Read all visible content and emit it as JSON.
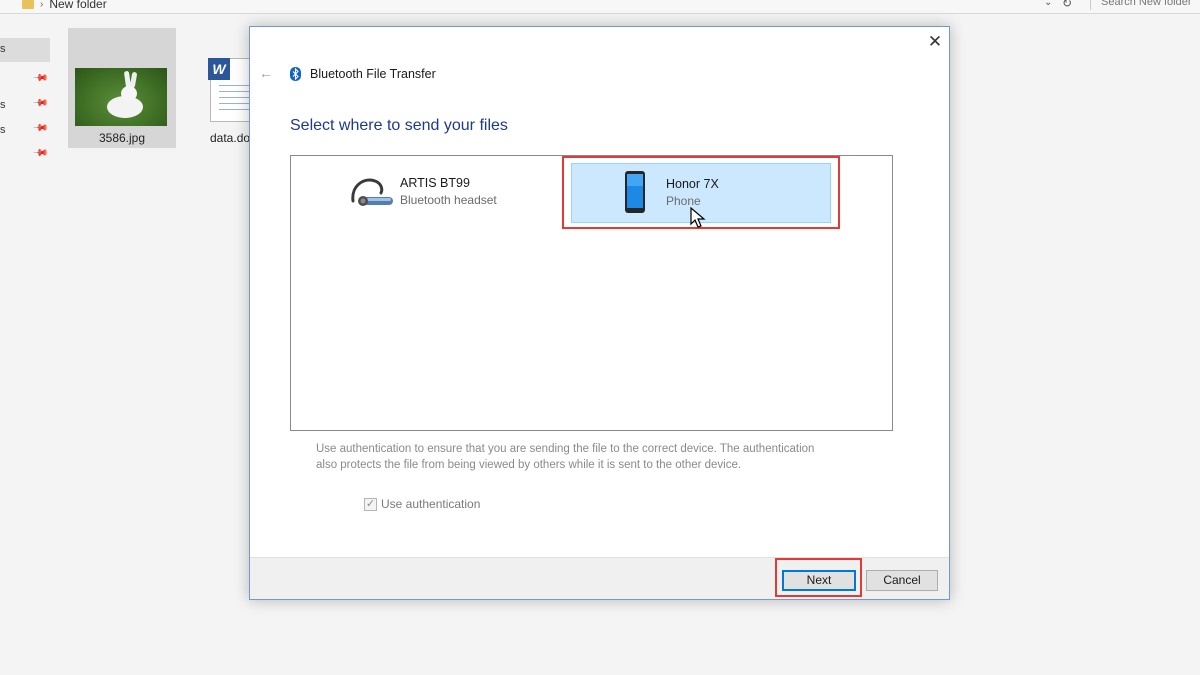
{
  "explorer": {
    "breadcrumb": "New folder",
    "search_placeholder": "Search New folder",
    "nav_items": [
      "s",
      "",
      "s",
      "s",
      ""
    ],
    "files": [
      {
        "name": "3586.jpg",
        "icon": "image-thumbnail"
      },
      {
        "name": "data.docx",
        "icon": "word-document-icon"
      }
    ]
  },
  "dialog": {
    "title": "Bluetooth File Transfer",
    "heading": "Select where to send your files",
    "close_glyph": "✕",
    "back_glyph": "←",
    "devices": [
      {
        "name": "ARTIS BT99",
        "type": "Bluetooth headset",
        "icon": "headset-icon",
        "selected": false
      },
      {
        "name": "Honor 7X",
        "type": "Phone",
        "icon": "phone-icon",
        "selected": true
      }
    ],
    "auth_description": "Use authentication to ensure that you are sending the file to the correct device. The authentication also protects the file from being viewed by others while it is sent to the other device.",
    "auth_checkbox_label": "Use authentication",
    "auth_checked": true,
    "buttons": {
      "next": "Next",
      "cancel": "Cancel"
    }
  },
  "colors": {
    "selection_fill": "#cce8ff",
    "highlight_box": "#e53935",
    "heading_blue": "#1e3a8a",
    "default_button_border": "#0078d7"
  }
}
